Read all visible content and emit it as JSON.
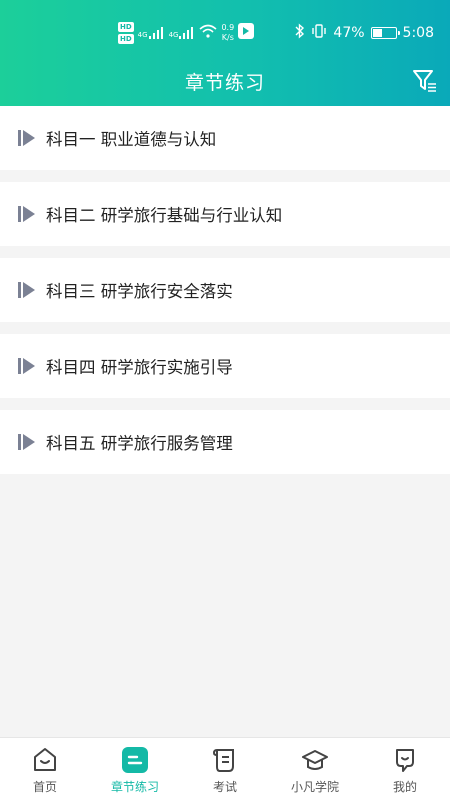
{
  "status": {
    "hd1": "HD",
    "hd2": "HD",
    "signal1": "4G",
    "signal2": "4G",
    "speed_value": "0.9",
    "speed_unit": "K/s",
    "battery": "47%",
    "battery_level": 0.47,
    "time": "5:08"
  },
  "header": {
    "title": "章节练习"
  },
  "chapters": [
    {
      "label": "科目一 职业道德与认知"
    },
    {
      "label": "科目二 研学旅行基础与行业认知"
    },
    {
      "label": "科目三 研学旅行安全落实"
    },
    {
      "label": "科目四 研学旅行实施引导"
    },
    {
      "label": "科目五 研学旅行服务管理"
    }
  ],
  "tabs": [
    {
      "label": "首页",
      "icon": "home-icon"
    },
    {
      "label": "章节练习",
      "icon": "chapter-icon",
      "active": true
    },
    {
      "label": "考试",
      "icon": "exam-scroll-icon"
    },
    {
      "label": "小凡学院",
      "icon": "graduation-cap-icon"
    },
    {
      "label": "我的",
      "icon": "profile-icon"
    }
  ],
  "colors": {
    "accent": "#14b9a6",
    "header_start": "#1ccf9a",
    "header_end": "#0aa9b9"
  }
}
